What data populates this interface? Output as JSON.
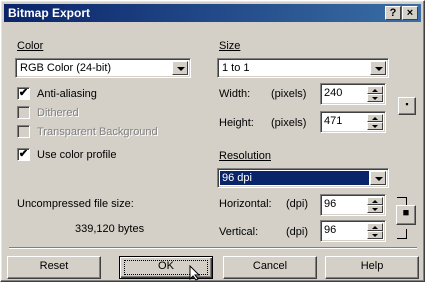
{
  "title": "Bitmap Export",
  "titlebar_buttons": {
    "help": "?",
    "close": "×"
  },
  "color": {
    "label": "Color",
    "mode": "RGB Color (24-bit)",
    "antialiasing": {
      "label": "Anti-aliasing",
      "checked": true
    },
    "dithered": {
      "label": "Dithered",
      "checked": false,
      "disabled": true
    },
    "transparent": {
      "label": "Transparent Background",
      "checked": false,
      "disabled": true
    },
    "use_profile": {
      "label": "Use color profile",
      "checked": true
    }
  },
  "size": {
    "label": "Size",
    "value": "1 to 1",
    "width_label": "Width:",
    "height_label": "Height:",
    "units": "(pixels)",
    "width": "240",
    "height": "471"
  },
  "resolution": {
    "label": "Resolution",
    "value": "96 dpi",
    "horizontal_label": "Horizontal:",
    "vertical_label": "Vertical:",
    "units": "(dpi)",
    "horizontal": "96",
    "vertical": "96"
  },
  "uncompressed": {
    "label": "Uncompressed file size:",
    "value": "339,120 bytes"
  },
  "buttons": {
    "reset": "Reset",
    "ok": "OK",
    "cancel": "Cancel",
    "help": "Help"
  },
  "check_glyph": "✔"
}
